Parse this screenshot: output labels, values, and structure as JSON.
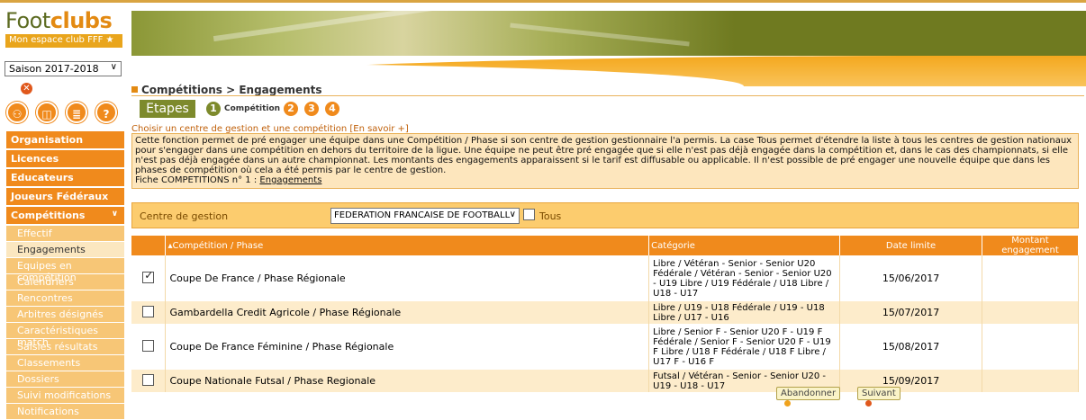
{
  "header": {
    "logo_part1": "Foot",
    "logo_part2": "clubs",
    "logo_subtitle": "Mon espace club FFF"
  },
  "season": {
    "selected": "Saison 2017-2018"
  },
  "quick_icons": [
    "users-icon",
    "file-search-icon",
    "list-icon",
    "help-icon"
  ],
  "nav": {
    "main_items": [
      {
        "label": "Organisation"
      },
      {
        "label": "Licences"
      },
      {
        "label": "Educateurs"
      },
      {
        "label": "Joueurs Fédéraux"
      },
      {
        "label": "Compétitions",
        "expanded": true
      }
    ],
    "sub_items": [
      {
        "label": "Effectif"
      },
      {
        "label": "Engagements",
        "active": true
      },
      {
        "label": "Equipes en compétition"
      },
      {
        "label": "Calendriers"
      },
      {
        "label": "Rencontres"
      },
      {
        "label": "Arbitres désignés"
      },
      {
        "label": "Caractéristiques match"
      },
      {
        "label": "Saisies résultats"
      },
      {
        "label": "Classements"
      },
      {
        "label": "Dossiers"
      },
      {
        "label": "Suivi modifications"
      },
      {
        "label": "Notifications"
      }
    ]
  },
  "page": {
    "title": "Compétitions > Engagements",
    "etapes_label": "Etapes",
    "steps": [
      "1",
      "2",
      "3",
      "4"
    ],
    "current_step_label": "Compétition",
    "choose_text": "Choisir un centre de gestion et une compétition [En savoir +]",
    "info_text": "Cette fonction permet de pré engager une équipe dans une Compétition / Phase si son centre de gestion gestionnaire l'a permis. La case Tous permet d'étendre la liste à tous les centres de gestion nationaux pour s'engager dans une compétition en dehors du territoire de la ligue. Une équipe ne peut être pré engagée que si elle n'est pas déjà engagée dans la compétition et, dans le cas des championnats, si elle n'est pas déjà engagée dans un autre championnat. Les montants des engagements apparaissent si le tarif est diffusable ou applicable. Il n'est possible de pré engager une nouvelle équipe que dans les phases de compétition où cela a été permis par le centre de gestion.",
    "fiche_text": "Fiche COMPETITIONS n° 1 : ",
    "fiche_link": "Engagements"
  },
  "filter": {
    "label": "Centre de gestion",
    "selected": "FEDERATION FRANCAISE DE FOOTBALL",
    "tous_label": "Tous",
    "tous_checked": false
  },
  "table": {
    "headers": [
      "",
      "Compétition / Phase",
      "Catégorie",
      "Date limite",
      "Montant engagement"
    ],
    "rows": [
      {
        "checked": true,
        "competition": "Coupe De France / Phase Régionale",
        "categorie": "Libre / Vétéran - Senior - Senior U20 Fédérale / Vétéran - Senior - Senior U20 - U19 Libre / U19 Fédérale / U18 Libre / U18 - U17",
        "date": "15/06/2017",
        "montant": ""
      },
      {
        "checked": false,
        "competition": "Gambardella Credit Agricole / Phase Régionale",
        "categorie": "Libre / U19 - U18 Fédérale / U19 - U18 Libre / U17 - U16",
        "date": "15/07/2017",
        "montant": ""
      },
      {
        "checked": false,
        "competition": "Coupe De France Féminine / Phase Régionale",
        "categorie": "Libre / Senior F - Senior U20 F - U19 F Fédérale / Senior F - Senior U20 F - U19 F Libre / U18 F Fédérale / U18 F Libre / U17 F - U16 F",
        "date": "15/08/2017",
        "montant": ""
      },
      {
        "checked": false,
        "competition": "Coupe Nationale Futsal / Phase Regionale",
        "categorie": "Futsal / Vétéran - Senior - Senior U20 - U19 - U18 - U17",
        "date": "15/09/2017",
        "montant": ""
      }
    ]
  },
  "buttons": {
    "abandon": "Abandonner",
    "next": "Suivant"
  },
  "colors": {
    "accent": "#f08a1c",
    "olive": "#7d8a2c",
    "step_active": "#7d8a2c",
    "step_inactive": "#f08a1c",
    "abandon_dot": "#f0a21c",
    "next_dot": "#e0581c"
  }
}
